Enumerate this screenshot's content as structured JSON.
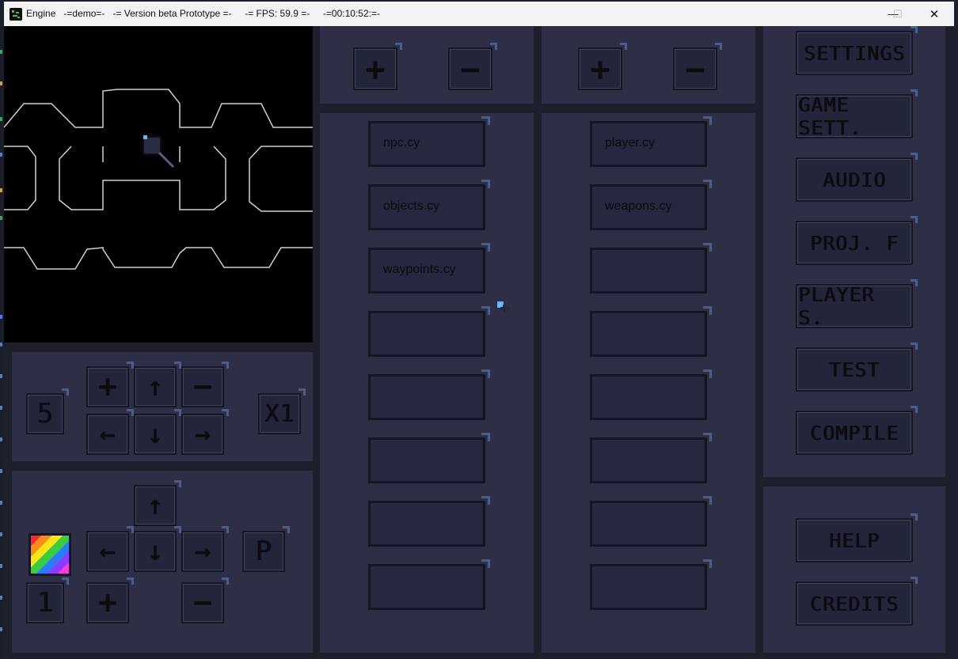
{
  "window": {
    "app_name": "Engine",
    "title_segments": [
      "-=demo=-",
      "-= Version beta Prototype =-",
      "-= FPS: 59.9 =-",
      "-=00:10:52:=-"
    ],
    "controls": {
      "minimize": "—",
      "maximize": "☐",
      "close": "✕"
    }
  },
  "scene_panel": {
    "zoom_in": "+",
    "zoom_out": "−",
    "up": "↑",
    "down": "↓",
    "left": "←",
    "right": "→",
    "speed_value": "5",
    "scale_value": "X1"
  },
  "tile_panel": {
    "up": "↑",
    "down": "↓",
    "left": "←",
    "right": "→",
    "p_label": "P",
    "layer_value": "1",
    "add": "+",
    "remove": "−"
  },
  "script_list_left": {
    "add": "+",
    "remove": "−",
    "files": [
      "npc.cy",
      "objects.cy",
      "waypoints.cy",
      "",
      "",
      "",
      "",
      ""
    ]
  },
  "script_list_right": {
    "add": "+",
    "remove": "−",
    "files": [
      "player.cy",
      "weapons.cy",
      "",
      "",
      "",
      "",
      "",
      ""
    ]
  },
  "menu": {
    "items": [
      "SETTINGS",
      "GAME SETT.",
      "AUDIO",
      "PROJ. F",
      "PLAYER S.",
      "TEST",
      "COMPILE"
    ],
    "help": "HELP",
    "credits": "CREDITS"
  }
}
